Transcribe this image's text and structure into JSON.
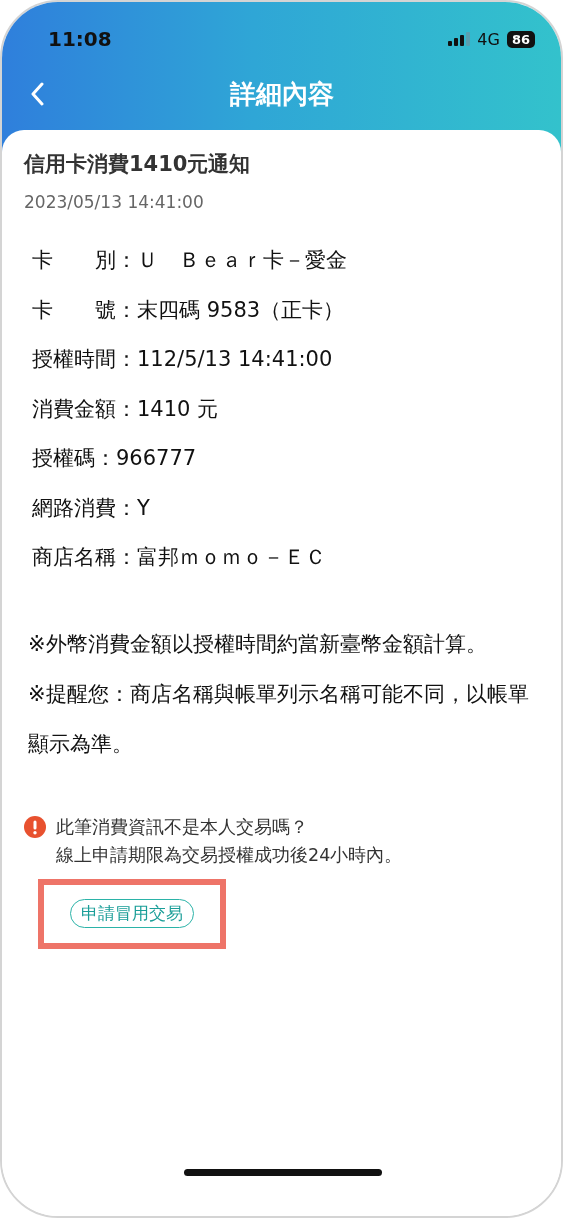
{
  "status_bar": {
    "time": "11:08",
    "network": "4G",
    "battery": "86"
  },
  "nav": {
    "title": "詳細內容"
  },
  "message": {
    "title": "信用卡消費1410元通知",
    "date": "2023/05/13 14:41:00",
    "lines": [
      "卡　　別：Ｕ　Ｂｅａｒ卡－愛金",
      "卡　　號：末四碼 9583（正卡）",
      "授權時間：112/5/13 14:41:00",
      "消費金額：1410 元",
      "授權碼：966777",
      "網路消費：Y",
      "商店名稱：富邦ｍｏｍｏ－ＥＣ"
    ],
    "notes": [
      "※外幣消費金額以授權時間約當新臺幣金額計算。",
      "※提醒您：商店名稱與帳單列示名稱可能不同，以帳單顯示為準。"
    ]
  },
  "fraud_notice": {
    "question": "此筆消費資訊不是本人交易嗎？",
    "deadline": "線上申請期限為交易授權成功後24小時內。",
    "button": {
      "label": "申請冒用交易",
      "highlighted": true
    }
  }
}
